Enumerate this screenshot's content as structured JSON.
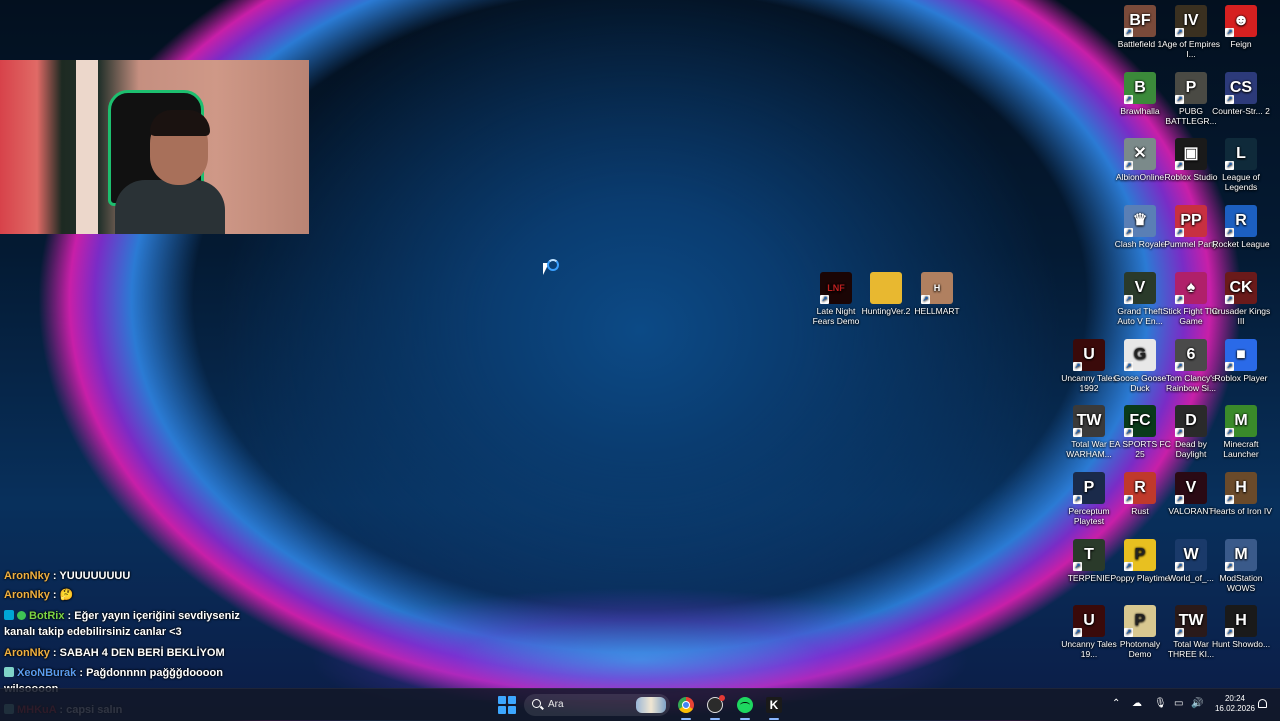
{
  "desktop_icons": [
    {
      "label": "Battlefield 1",
      "color": "#7a4a3a",
      "glyph": "BF"
    },
    {
      "label": "Age of Empires I...",
      "color": "#3a3020",
      "glyph": "IV"
    },
    {
      "label": "Feign",
      "color": "#d62020",
      "glyph": "☻"
    },
    {
      "label": "Brawlhalla",
      "color": "#3b8a3a",
      "glyph": "B"
    },
    {
      "label": "PUBG BATTLEGR...",
      "color": "#4a4a44",
      "glyph": "P"
    },
    {
      "label": "Counter-Str... 2",
      "color": "#2c3a7a",
      "glyph": "CS"
    },
    {
      "label": "AlbionOnline",
      "color": "#7b8a8a",
      "glyph": "✕"
    },
    {
      "label": "Roblox Studio",
      "color": "#1a1a1a",
      "glyph": "▣"
    },
    {
      "label": "League of Legends",
      "color": "#0f2a3a",
      "glyph": "L"
    },
    {
      "label": "Clash Royale",
      "color": "#5a7fb5",
      "glyph": "♛"
    },
    {
      "label": "Pummel Party",
      "color": "#c83040",
      "glyph": "PP"
    },
    {
      "label": "Rocket League",
      "color": "#1c5fc0",
      "glyph": "R"
    },
    {
      "label": "Grand Theft Auto V En...",
      "color": "#2a3a2a",
      "glyph": "V"
    },
    {
      "label": "Stick Fight The Game",
      "color": "#b0206a",
      "glyph": "♠"
    },
    {
      "label": "Crusader Kings III",
      "color": "#6a1a1a",
      "glyph": "CK"
    },
    {
      "label": "Uncanny Tales 1992",
      "color": "#3a0a0a",
      "glyph": "U"
    },
    {
      "label": "Goose Goose Duck",
      "color": "#e8e8e8",
      "glyph": "G"
    },
    {
      "label": "Tom Clancy's Rainbow Si...",
      "color": "#4a4a4a",
      "glyph": "6"
    },
    {
      "label": "Roblox Player",
      "color": "#2a6ae8",
      "glyph": "■"
    },
    {
      "label": "Total War WARHAM...",
      "color": "#3a3a3a",
      "glyph": "TW"
    },
    {
      "label": "EA SPORTS FC 25",
      "color": "#0a3a1a",
      "glyph": "FC"
    },
    {
      "label": "Dead by Daylight",
      "color": "#2a2a2a",
      "glyph": "D"
    },
    {
      "label": "Minecraft Launcher",
      "color": "#3a8a2a",
      "glyph": "M"
    },
    {
      "label": "Perceptum Playtest",
      "color": "#1a2a4a",
      "glyph": "P"
    },
    {
      "label": "Rust",
      "color": "#c0392b",
      "glyph": "R"
    },
    {
      "label": "VALORANT",
      "color": "#2a0a14",
      "glyph": "V"
    },
    {
      "label": "Hearts of Iron IV",
      "color": "#6a4a2a",
      "glyph": "H"
    },
    {
      "label": "TERPENIE",
      "color": "#2a3a2a",
      "glyph": "T"
    },
    {
      "label": "Poppy Playtime",
      "color": "#e8c020",
      "glyph": "P"
    },
    {
      "label": "World_of_...",
      "color": "#1a3a6a",
      "glyph": "W"
    },
    {
      "label": "ModStation WOWS",
      "color": "#3a5a8a",
      "glyph": "M"
    },
    {
      "label": "Uncanny Tales 19...",
      "color": "#3a0a0a",
      "glyph": "U"
    },
    {
      "label": "Photomaly Demo",
      "color": "#d8c890",
      "glyph": "P"
    },
    {
      "label": "Total War THREE KI...",
      "color": "#2a1a1a",
      "glyph": "TW"
    },
    {
      "label": "Hunt Showdo...",
      "color": "#1a1a1a",
      "glyph": "H"
    }
  ],
  "center_icons": [
    {
      "label": "Late Night Fears Demo",
      "color": "#1a0505",
      "glyph": "LNF"
    },
    {
      "label": "HuntingVer.2",
      "color": "#e8b830",
      "glyph": "📁"
    },
    {
      "label": "HELLMART",
      "color": "#b08060",
      "glyph": "H"
    }
  ],
  "chat": [
    {
      "user": "AronNky",
      "user_color": "#f0b040",
      "text": " : YUUUUUUUU",
      "badge": ""
    },
    {
      "user": "AronNky",
      "user_color": "#f0b040",
      "text": " : 🤔",
      "badge": ""
    },
    {
      "user": "BotRix",
      "user_color": "#7cd444",
      "text": " : Eğer yayın içeriğini sevdiyseniz",
      "badge": "bot"
    },
    {
      "user": "",
      "user_color": "#ffffff",
      "text": "kanalı takip edebilirsiniz canlar <3",
      "badge": ""
    },
    {
      "user": "AronNky",
      "user_color": "#f0b040",
      "text": " : SABAH 4 DEN BERİ BEKLİYOM",
      "badge": ""
    },
    {
      "user": "XeoNBurak",
      "user_color": "#5a9cf0",
      "text": " : Pağdonnnn pağğğdoooon",
      "badge": "sub"
    },
    {
      "user": "",
      "user_color": "#ffffff",
      "text": "wilsoooon",
      "badge": ""
    },
    {
      "user": "MHKuA",
      "user_color": "#e83030",
      "text": " : capsi salın",
      "badge": "sub"
    }
  ],
  "taskbar": {
    "search_placeholder": "Ara",
    "time": "20:24",
    "date": "16.02.2026"
  }
}
